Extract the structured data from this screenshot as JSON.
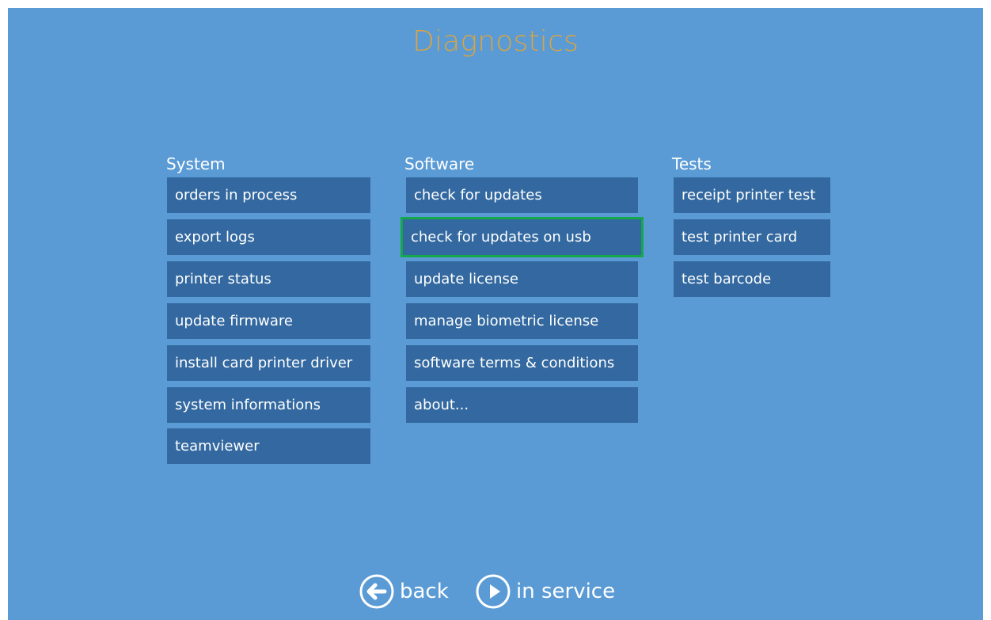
{
  "page": {
    "title": "Diagnostics"
  },
  "columns": {
    "system": {
      "title": "System",
      "items": [
        "orders in process",
        "export logs",
        "printer status",
        "update firmware",
        "install card printer driver",
        "system informations",
        "teamviewer"
      ]
    },
    "software": {
      "title": "Software",
      "items": [
        "check for updates",
        "check for updates on usb",
        "update license",
        "manage biometric license",
        "software terms & conditions",
        "about..."
      ],
      "selected_index": 1
    },
    "tests": {
      "title": "Tests",
      "items": [
        "receipt printer test",
        "test printer card",
        "test barcode"
      ]
    }
  },
  "footer": {
    "back": {
      "label": "back",
      "icon": "back-arrow-icon"
    },
    "in_service": {
      "label": "in service",
      "icon": "play-icon"
    }
  },
  "colors": {
    "background": "#5b9bd5",
    "title": "#d9a441",
    "button": "#3369a0",
    "text": "#ffffff",
    "selected_outline": "#14a84a"
  }
}
